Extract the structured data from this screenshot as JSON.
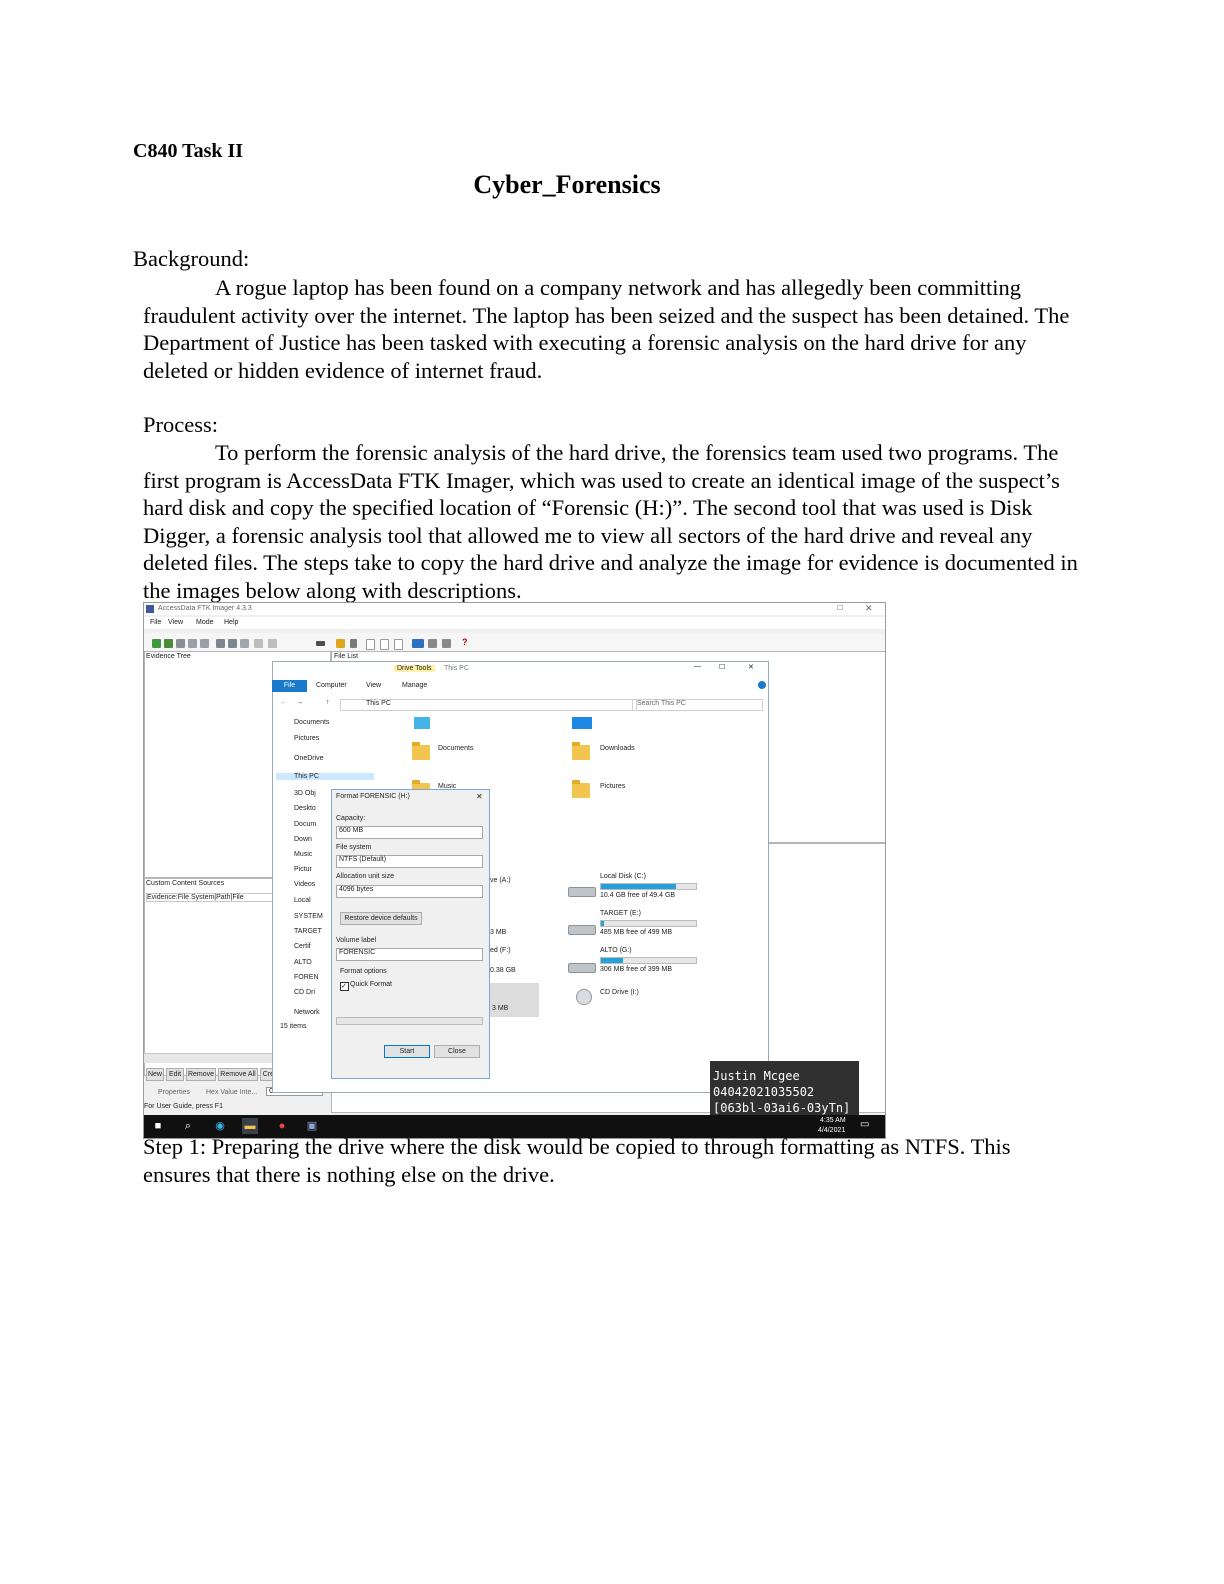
{
  "header": {
    "task_label": "C840 Task II",
    "title": "Cyber_Forensics"
  },
  "background": {
    "heading": "Background:",
    "paragraph": "A rogue laptop has been found on a company network and has allegedly been committing fraudulent activity over the internet. The laptop has been seized and the suspect has been detained. The Department of Justice has been tasked with executing a forensic analysis on the hard drive for any deleted or hidden evidence of internet fraud."
  },
  "process": {
    "heading": "Process:",
    "paragraph": "To perform the forensic analysis of the hard drive, the forensics team used two programs. The first program is AccessData FTK Imager, which was used to create an identical image of the suspect’s hard disk and copy the specified location of “Forensic (H:)”. The second tool that was used is Disk Digger, a forensic analysis tool that allowed me to view all sectors of the hard drive and reveal any deleted files. The steps take to copy the hard drive and analyze the image for evidence is documented in the images below along with descriptions."
  },
  "screenshot": {
    "ftk": {
      "title": "AccessData FTK Imager 4.3.3",
      "menu": [
        "File",
        "View",
        "Mode",
        "Help"
      ],
      "evidence_tree": "Evidence Tree",
      "file_list": "File List",
      "custom_content": "Custom Content Sources",
      "custom_row": "Evidence:File System|Path|File",
      "buttons": [
        "New",
        "Edit",
        "Remove",
        "Remove All",
        "Create Image"
      ],
      "tabs": [
        "Properties",
        "Hex Value Inte...",
        "Custom Conte..."
      ],
      "status": "For User Guide, press F1"
    },
    "explorer": {
      "drive_tools": "Drive Tools",
      "this_pc": "This PC",
      "ribbon": [
        "File",
        "Computer",
        "View",
        "Manage"
      ],
      "address": "This PC",
      "search": "Search This PC",
      "nav": [
        "Documents",
        "Pictures",
        "OneDrive",
        "This PC",
        "3D Obj",
        "Deskto",
        "Docum",
        "Down",
        "Music",
        "Pictur",
        "Videos",
        "Local",
        "SYSTEM",
        "TARGET",
        "Certif",
        "ALTO",
        "FOREN",
        "CD Dri",
        "Network"
      ],
      "folders": [
        "Documents",
        "Downloads",
        "Music",
        "Pictures"
      ],
      "drives": [
        {
          "name": "Local Disk (C:)",
          "free": "10.4 GB free of 49.4 GB",
          "fill": 0.79
        },
        {
          "name": "TARGET (E:)",
          "free": "485 MB free of 499 MB",
          "fill": 0.03
        },
        {
          "name": "ALTO (G:)",
          "free": "306 MB free of 399 MB",
          "fill": 0.23
        },
        {
          "name": "CD Drive (I:)",
          "free": "",
          "fill": 0
        }
      ],
      "partial_labels": [
        "ve (A:)",
        "3 MB",
        "ed (F:)",
        "0.38 GB",
        "3 MB"
      ],
      "count": "15 items"
    },
    "format_dialog": {
      "title": "Format FORENSIC (H:)",
      "capacity_label": "Capacity:",
      "capacity_value": "600 MB",
      "fs_label": "File system",
      "fs_value": "NTFS (Default)",
      "alloc_label": "Allocation unit size",
      "alloc_value": "4096 bytes",
      "restore": "Restore device defaults",
      "volume_label": "Volume label",
      "volume_value": "FORENSIC",
      "options_label": "Format options",
      "quick_format": "Quick Format",
      "start": "Start",
      "close": "Close"
    },
    "watermark": {
      "line1": "Justin Mcgee",
      "line2": "04042021035502",
      "line3": "[063bl-03ai6-03yTn]"
    },
    "taskbar": {
      "time": "4:35 AM",
      "date": "4/4/2021"
    }
  },
  "step1": {
    "text": "Step 1: Preparing the drive where the disk would be copied to through formatting as NTFS. This ensures that there is nothing else on the drive."
  }
}
